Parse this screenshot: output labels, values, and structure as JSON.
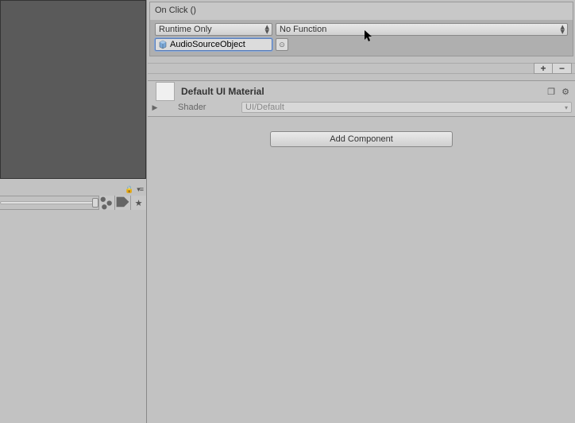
{
  "onclick": {
    "header_label": "On Click ()",
    "runtime_selected": "Runtime Only",
    "function_selected": "No Function",
    "object_reference": "AudioSourceObject"
  },
  "material": {
    "title": "Default UI Material",
    "shader_label": "Shader",
    "shader_value": "UI/Default"
  },
  "add_component": {
    "label": "Add Component"
  },
  "icons": {
    "plus": "+",
    "minus": "−",
    "lock": "🔒",
    "menu": "▾≡",
    "expand": "▶",
    "picker": "⊙",
    "gear": "⚙",
    "book": "❐"
  }
}
